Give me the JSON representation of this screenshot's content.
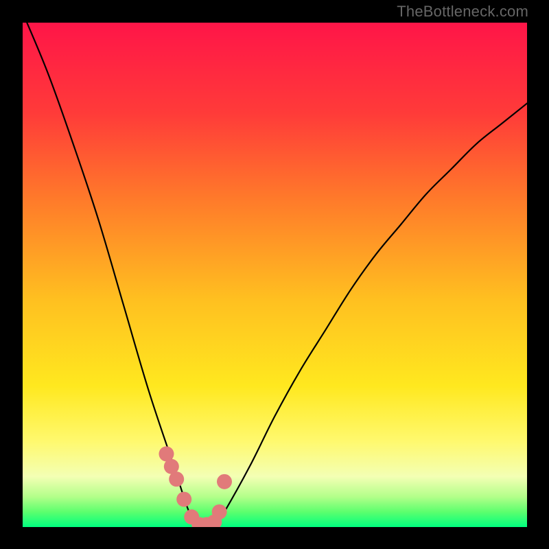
{
  "attribution": "TheBottleneck.com",
  "chart_data": {
    "type": "line",
    "title": "",
    "xlabel": "",
    "ylabel": "",
    "xlim": [
      0,
      100
    ],
    "ylim": [
      0,
      100
    ],
    "grid": false,
    "legend": false,
    "series": [
      {
        "name": "curve-left",
        "x": [
          0,
          5,
          10,
          15,
          20,
          25,
          30,
          33,
          35
        ],
        "y": [
          102,
          90,
          76,
          61,
          44,
          27,
          12,
          3,
          0
        ]
      },
      {
        "name": "curve-right",
        "x": [
          38,
          40,
          45,
          50,
          55,
          60,
          65,
          70,
          75,
          80,
          85,
          90,
          95,
          100
        ],
        "y": [
          0,
          3,
          12,
          22,
          31,
          39,
          47,
          54,
          60,
          66,
          71,
          76,
          80,
          84
        ]
      },
      {
        "name": "markers",
        "x": [
          28.5,
          29.5,
          30.5,
          32.0,
          33.5,
          35.0,
          36.5,
          38.0,
          39.0,
          40.0
        ],
        "y": [
          14.5,
          12.0,
          9.5,
          5.5,
          2.0,
          0.5,
          0.5,
          1.0,
          3.0,
          9.0
        ]
      }
    ],
    "colors": {
      "curve": "#000000",
      "markers": "#e17a7a",
      "green_band_top": "#7bff4e",
      "green_band_bottom": "#00ff7f"
    },
    "gradient_stops": [
      {
        "offset": 0.0,
        "color": "#ff1548"
      },
      {
        "offset": 0.18,
        "color": "#ff3b39"
      },
      {
        "offset": 0.35,
        "color": "#ff7a2a"
      },
      {
        "offset": 0.55,
        "color": "#ffc020"
      },
      {
        "offset": 0.72,
        "color": "#ffe81f"
      },
      {
        "offset": 0.83,
        "color": "#fff96e"
      },
      {
        "offset": 0.9,
        "color": "#f3ffb4"
      },
      {
        "offset": 0.94,
        "color": "#b3ff8a"
      },
      {
        "offset": 0.97,
        "color": "#5cff6e"
      },
      {
        "offset": 1.0,
        "color": "#00ff7f"
      }
    ]
  }
}
